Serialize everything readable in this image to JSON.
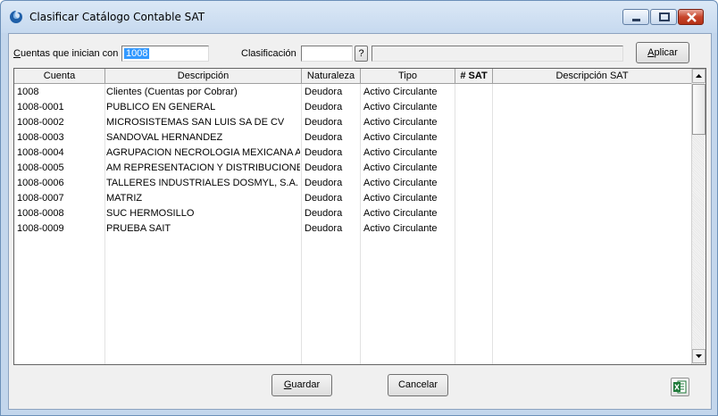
{
  "window": {
    "title": "Clasificar Catálogo Contable SAT",
    "app_icon": "swirl-app-icon",
    "controls": {
      "minimize": "minimize-icon",
      "maximize": "maximize-icon",
      "close": "close-icon"
    }
  },
  "filters": {
    "cuentas_label_accel": "C",
    "cuentas_label_rest": "uentas que inician con",
    "cuentas_value": "1008",
    "clasificacion_label": "Clasificación",
    "clasificacion_value": "",
    "help_button": "?",
    "description_value": "",
    "aplicar_accel": "A",
    "aplicar_rest": "plicar"
  },
  "grid": {
    "columns": [
      "Cuenta",
      "Descripción",
      "Naturaleza",
      "Tipo",
      "# SAT",
      "Descripción SAT"
    ],
    "rows": [
      {
        "cuenta": "1008",
        "descripcion": "Clientes (Cuentas por Cobrar)",
        "naturaleza": "Deudora",
        "tipo": "Activo Circulante",
        "sat": "",
        "desc_sat": ""
      },
      {
        "cuenta": "1008-0001",
        "descripcion": "PUBLICO EN GENERAL",
        "naturaleza": "Deudora",
        "tipo": "Activo Circulante",
        "sat": "",
        "desc_sat": ""
      },
      {
        "cuenta": "1008-0002",
        "descripcion": "MICROSISTEMAS SAN LUIS SA DE CV",
        "naturaleza": "Deudora",
        "tipo": "Activo Circulante",
        "sat": "",
        "desc_sat": ""
      },
      {
        "cuenta": "1008-0003",
        "descripcion": "SANDOVAL HERNANDEZ",
        "naturaleza": "Deudora",
        "tipo": "Activo Circulante",
        "sat": "",
        "desc_sat": ""
      },
      {
        "cuenta": "1008-0004",
        "descripcion": "AGRUPACION NECROLOGIA MEXICANA AC",
        "naturaleza": "Deudora",
        "tipo": "Activo Circulante",
        "sat": "",
        "desc_sat": ""
      },
      {
        "cuenta": "1008-0005",
        "descripcion": "AM REPRESENTACION Y DISTRIBUCIONES DE",
        "naturaleza": "Deudora",
        "tipo": "Activo Circulante",
        "sat": "",
        "desc_sat": ""
      },
      {
        "cuenta": "1008-0006",
        "descripcion": "TALLERES INDUSTRIALES DOSMYL, S.A. DE",
        "naturaleza": "Deudora",
        "tipo": "Activo Circulante",
        "sat": "",
        "desc_sat": ""
      },
      {
        "cuenta": "1008-0007",
        "descripcion": "MATRIZ",
        "naturaleza": "Deudora",
        "tipo": "Activo Circulante",
        "sat": "",
        "desc_sat": ""
      },
      {
        "cuenta": "1008-0008",
        "descripcion": "SUC HERMOSILLO",
        "naturaleza": "Deudora",
        "tipo": "Activo Circulante",
        "sat": "",
        "desc_sat": ""
      },
      {
        "cuenta": "1008-0009",
        "descripcion": "PRUEBA SAIT",
        "naturaleza": "Deudora",
        "tipo": "Activo Circulante",
        "sat": "",
        "desc_sat": ""
      }
    ],
    "scroll_icons": {
      "up": "scroll-up-arrow-icon",
      "down": "scroll-down-arrow-icon"
    }
  },
  "footer": {
    "guardar_accel": "G",
    "guardar_rest": "uardar",
    "cancelar": "Cancelar",
    "excel_icon": "excel-export-icon"
  },
  "colors": {
    "selection": "#3399ff",
    "excel_green": "#1f7a3a",
    "close_red": "#c7452c"
  }
}
